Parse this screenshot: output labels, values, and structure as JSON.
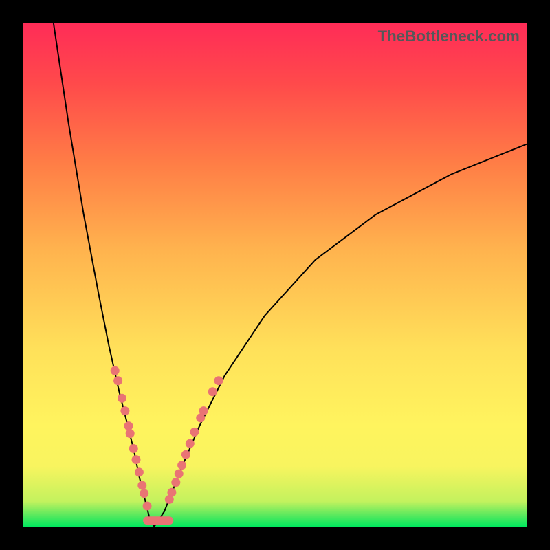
{
  "watermark": "TheBottleneck.com",
  "colors": {
    "background_frame": "#000000",
    "bead": "#e97474",
    "curve": "#000000",
    "gradient_top": "#ff2c57",
    "gradient_bottom": "#00e85e"
  },
  "chart_data": {
    "type": "line",
    "title": "",
    "xlabel": "",
    "ylabel": "",
    "xlim": [
      0,
      100
    ],
    "ylim": [
      0,
      100
    ],
    "annotations": [
      "TheBottleneck.com"
    ],
    "note": "Stylized bottleneck curve. The y-axis represents bottleneck percentage (high at top, zero at the green bottom). Two black branches form a V meeting near x≈26 at y≈0; beads mark points on each branch in the lower region.",
    "series": [
      {
        "name": "left-branch",
        "x": [
          6,
          9,
          12,
          15,
          17,
          19,
          20.5,
          22,
          23,
          24,
          25,
          26
        ],
        "y": [
          100,
          80,
          62,
          46,
          36,
          27,
          21,
          15,
          10,
          6,
          2,
          0
        ]
      },
      {
        "name": "right-branch",
        "x": [
          26,
          28,
          30,
          32,
          35,
          40,
          48,
          58,
          70,
          85,
          100
        ],
        "y": [
          0,
          3,
          8,
          13,
          20,
          30,
          42,
          53,
          62,
          70,
          76
        ]
      }
    ],
    "beads_left": [
      {
        "x": 18.2,
        "y": 31
      },
      {
        "x": 18.8,
        "y": 29
      },
      {
        "x": 19.6,
        "y": 25.5
      },
      {
        "x": 20.2,
        "y": 23
      },
      {
        "x": 20.9,
        "y": 20
      },
      {
        "x": 21.2,
        "y": 18.5
      },
      {
        "x": 21.9,
        "y": 15.5
      },
      {
        "x": 22.4,
        "y": 13.3
      },
      {
        "x": 23.0,
        "y": 10.8
      },
      {
        "x": 23.6,
        "y": 8.2
      },
      {
        "x": 24.0,
        "y": 6.6
      },
      {
        "x": 24.6,
        "y": 4.1
      }
    ],
    "beads_right": [
      {
        "x": 29.0,
        "y": 5.4
      },
      {
        "x": 29.5,
        "y": 6.8
      },
      {
        "x": 30.3,
        "y": 8.8
      },
      {
        "x": 30.9,
        "y": 10.5
      },
      {
        "x": 31.5,
        "y": 12.2
      },
      {
        "x": 32.3,
        "y": 14.3
      },
      {
        "x": 33.1,
        "y": 16.5
      },
      {
        "x": 34.0,
        "y": 18.8
      },
      {
        "x": 35.2,
        "y": 21.6
      },
      {
        "x": 35.8,
        "y": 23.0
      },
      {
        "x": 37.6,
        "y": 26.8
      },
      {
        "x": 38.8,
        "y": 29.0
      }
    ],
    "bottom_band": {
      "x_start": 24.6,
      "x_end": 29.0,
      "y": 1.2
    }
  }
}
